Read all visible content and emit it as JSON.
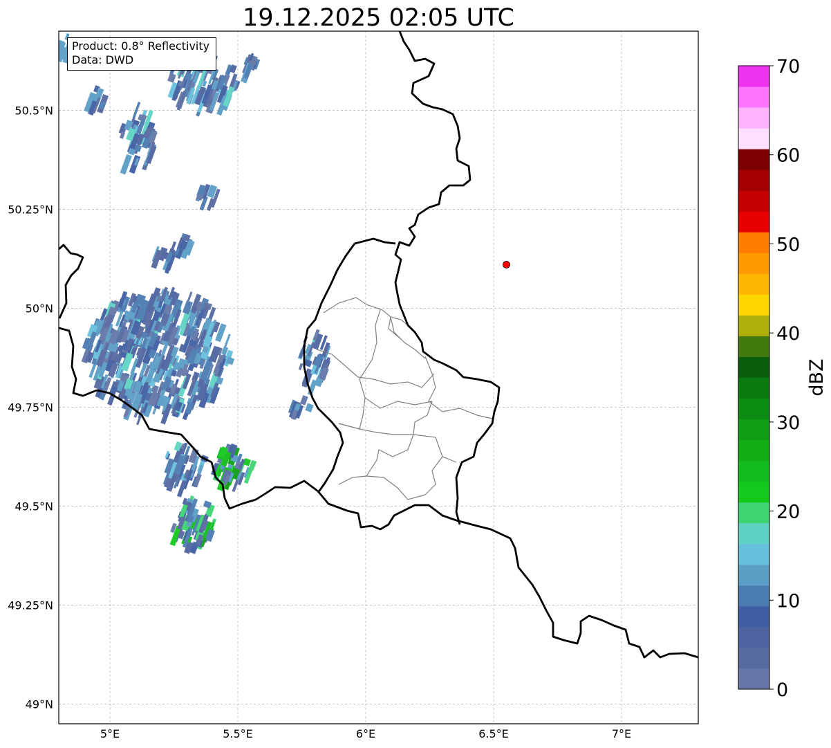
{
  "title": "19.12.2025 02:05 UTC",
  "info": {
    "product": "Product: 0.8° Reflectivity",
    "data_source": "Data: DWD"
  },
  "axes": {
    "lon_ticks": [
      {
        "value": 5.0,
        "label": "5°E"
      },
      {
        "value": 5.5,
        "label": "5.5°E"
      },
      {
        "value": 6.0,
        "label": "6°E"
      },
      {
        "value": 6.5,
        "label": "6.5°E"
      },
      {
        "value": 7.0,
        "label": "7°E"
      }
    ],
    "lat_ticks": [
      {
        "value": 50.5,
        "label": "50.5°N"
      },
      {
        "value": 50.25,
        "label": "50.25°N"
      },
      {
        "value": 50.0,
        "label": "50°N"
      },
      {
        "value": 49.75,
        "label": "49.75°N"
      },
      {
        "value": 49.5,
        "label": "49.5°N"
      },
      {
        "value": 49.25,
        "label": "49.25°N"
      },
      {
        "value": 49.0,
        "label": "49°N"
      }
    ],
    "lon_range": [
      4.8,
      7.3
    ],
    "lat_range": [
      48.95,
      50.7
    ],
    "grid": true
  },
  "marker": {
    "lon": 6.55,
    "lat": 50.11,
    "color": "#ff0000"
  },
  "colorbar": {
    "unit": "dBZ",
    "min": 0,
    "max": 70,
    "tick_labels": [
      "0",
      "10",
      "20",
      "30",
      "40",
      "50",
      "60",
      "70"
    ],
    "colors": [
      "#6477a6",
      "#5669a0",
      "#4e64a0",
      "#405ea3",
      "#4b7cb1",
      "#5b9ec6",
      "#66bfdc",
      "#5ed3c3",
      "#3ed472",
      "#12c91c",
      "#11bc1c",
      "#11ae18",
      "#0f9e15",
      "#0d8c13",
      "#0b7a10",
      "#095e0b",
      "#437a0d",
      "#aeb10b",
      "#ffd700",
      "#ffb600",
      "#ff9900",
      "#ff7d00",
      "#e60000",
      "#c40000",
      "#a50000",
      "#7f0000",
      "#ffdfff",
      "#ffb3ff",
      "#ff75ff",
      "#ee33ee"
    ]
  }
}
